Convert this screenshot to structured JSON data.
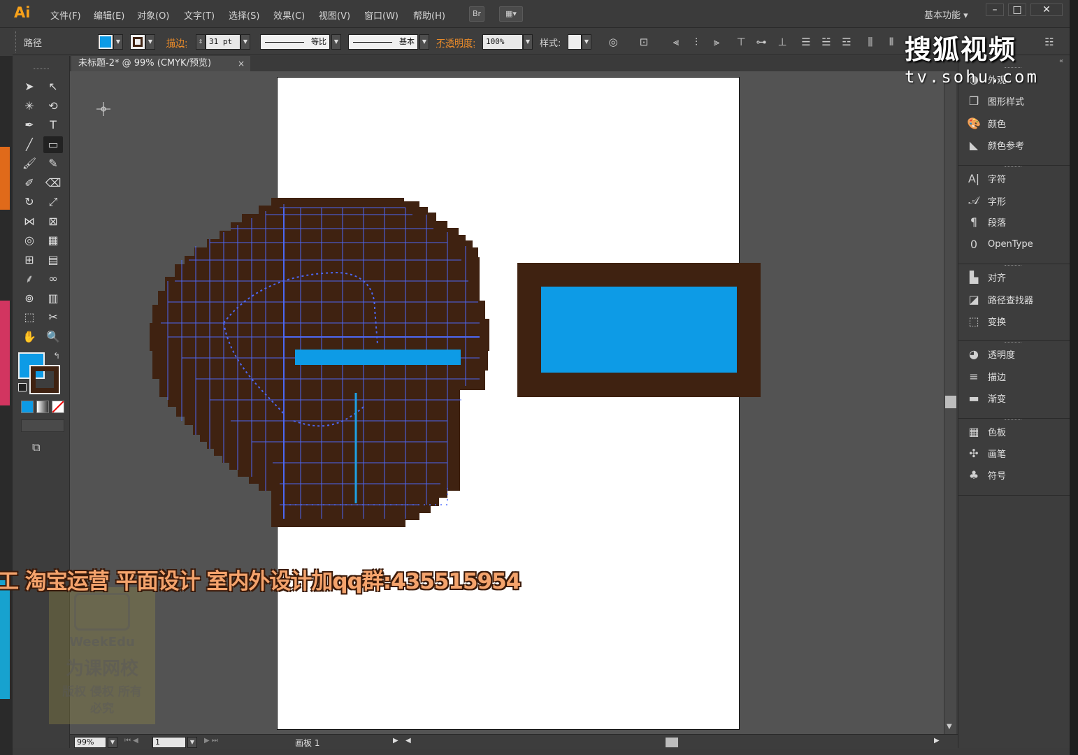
{
  "app": {
    "logo": "Ai",
    "menus": [
      "文件(F)",
      "编辑(E)",
      "对象(O)",
      "文字(T)",
      "选择(S)",
      "效果(C)",
      "视图(V)",
      "窗口(W)",
      "帮助(H)"
    ],
    "bridge_btn": "Br",
    "workspace": "基本功能",
    "window_controls": [
      "–",
      "□",
      "✕"
    ]
  },
  "control_bar": {
    "selection_type": "路径",
    "fill_color": "#0d9be6",
    "stroke_label": "描边:",
    "stroke_weight": "31 pt",
    "profile_label": "等比",
    "brush_label": "基本",
    "opacity_label": "不透明度:",
    "opacity_value": "100%",
    "style_label": "样式:"
  },
  "document": {
    "tab_title": "未标题-2* @ 99% (CMYK/预览)",
    "tab_close": "×"
  },
  "tools": {
    "icons": [
      "selection-icon",
      "direct-selection-icon",
      "magic-wand-icon",
      "lasso-icon",
      "pen-icon",
      "type-icon",
      "line-icon",
      "rectangle-icon",
      "paintbrush-icon",
      "pencil-icon",
      "blob-brush-icon",
      "eraser-icon",
      "rotate-icon",
      "scale-icon",
      "width-icon",
      "free-transform-icon",
      "shape-builder-icon",
      "perspective-grid-icon",
      "mesh-icon",
      "gradient-icon",
      "eyedropper-icon",
      "blend-icon",
      "symbol-sprayer-icon",
      "column-graph-icon",
      "artboard-icon",
      "slice-icon",
      "hand-icon",
      "zoom-icon"
    ],
    "glyphs": [
      "➤",
      "↖",
      "✳",
      "⟲",
      "✒",
      "T",
      "╱",
      "▭",
      "🖌",
      "✎",
      "✐",
      "⌫",
      "↻",
      "⤢",
      "⋈",
      "⊠",
      "◎",
      "▦",
      "⊞",
      "▤",
      "⸙",
      "∞",
      "⊚",
      "▥",
      "⬚",
      "✂",
      "✋",
      "🔍"
    ],
    "fill": "#0d9be6",
    "stroke": "#3f2211"
  },
  "artwork": {
    "brown": "#3f2211",
    "blue": "#0d9be6",
    "path_color": "#4d6bff"
  },
  "status_bar": {
    "zoom": "99%",
    "page": "1",
    "artboard_label": "画板",
    "artboard_num": "1"
  },
  "right_panel": {
    "groups": [
      [
        {
          "icon": "appearance-icon",
          "glyph": "◑",
          "label": "外观"
        },
        {
          "icon": "graphic-styles-icon",
          "glyph": "❒",
          "label": "图形样式"
        },
        {
          "icon": "color-icon",
          "glyph": "🎨",
          "label": "颜色"
        },
        {
          "icon": "color-guide-icon",
          "glyph": "◣",
          "label": "颜色参考"
        }
      ],
      [
        {
          "icon": "character-icon",
          "glyph": "A|",
          "label": "字符"
        },
        {
          "icon": "glyphs-icon",
          "glyph": "𝒜",
          "label": "字形"
        },
        {
          "icon": "paragraph-icon",
          "glyph": "¶",
          "label": "段落"
        },
        {
          "icon": "opentype-icon",
          "glyph": "0",
          "label": "OpenType"
        }
      ],
      [
        {
          "icon": "align-icon",
          "glyph": "▙",
          "label": "对齐"
        },
        {
          "icon": "pathfinder-icon",
          "glyph": "◪",
          "label": "路径查找器"
        },
        {
          "icon": "transform-icon",
          "glyph": "⬚",
          "label": "变换"
        }
      ],
      [
        {
          "icon": "transparency-icon",
          "glyph": "◕",
          "label": "透明度"
        },
        {
          "icon": "stroke-icon",
          "glyph": "≡",
          "label": "描边"
        },
        {
          "icon": "gradient-panel-icon",
          "glyph": "▬",
          "label": "渐变"
        }
      ],
      [
        {
          "icon": "swatches-icon",
          "glyph": "▦",
          "label": "色板"
        },
        {
          "icon": "brushes-icon",
          "glyph": "✣",
          "label": "画笔"
        },
        {
          "icon": "symbols-icon",
          "glyph": "♣",
          "label": "符号"
        }
      ]
    ]
  },
  "overlays": {
    "sohu_logo": "搜狐视频",
    "sohu_url": "tv.sohu.com",
    "banner": "工 淘宝运营 平面设计 室内外设计加qq群:435515954",
    "watermark_brand": "WeekEdu",
    "watermark_name": "为课网校",
    "watermark_rights": "版权 侵权 所有 必究"
  }
}
